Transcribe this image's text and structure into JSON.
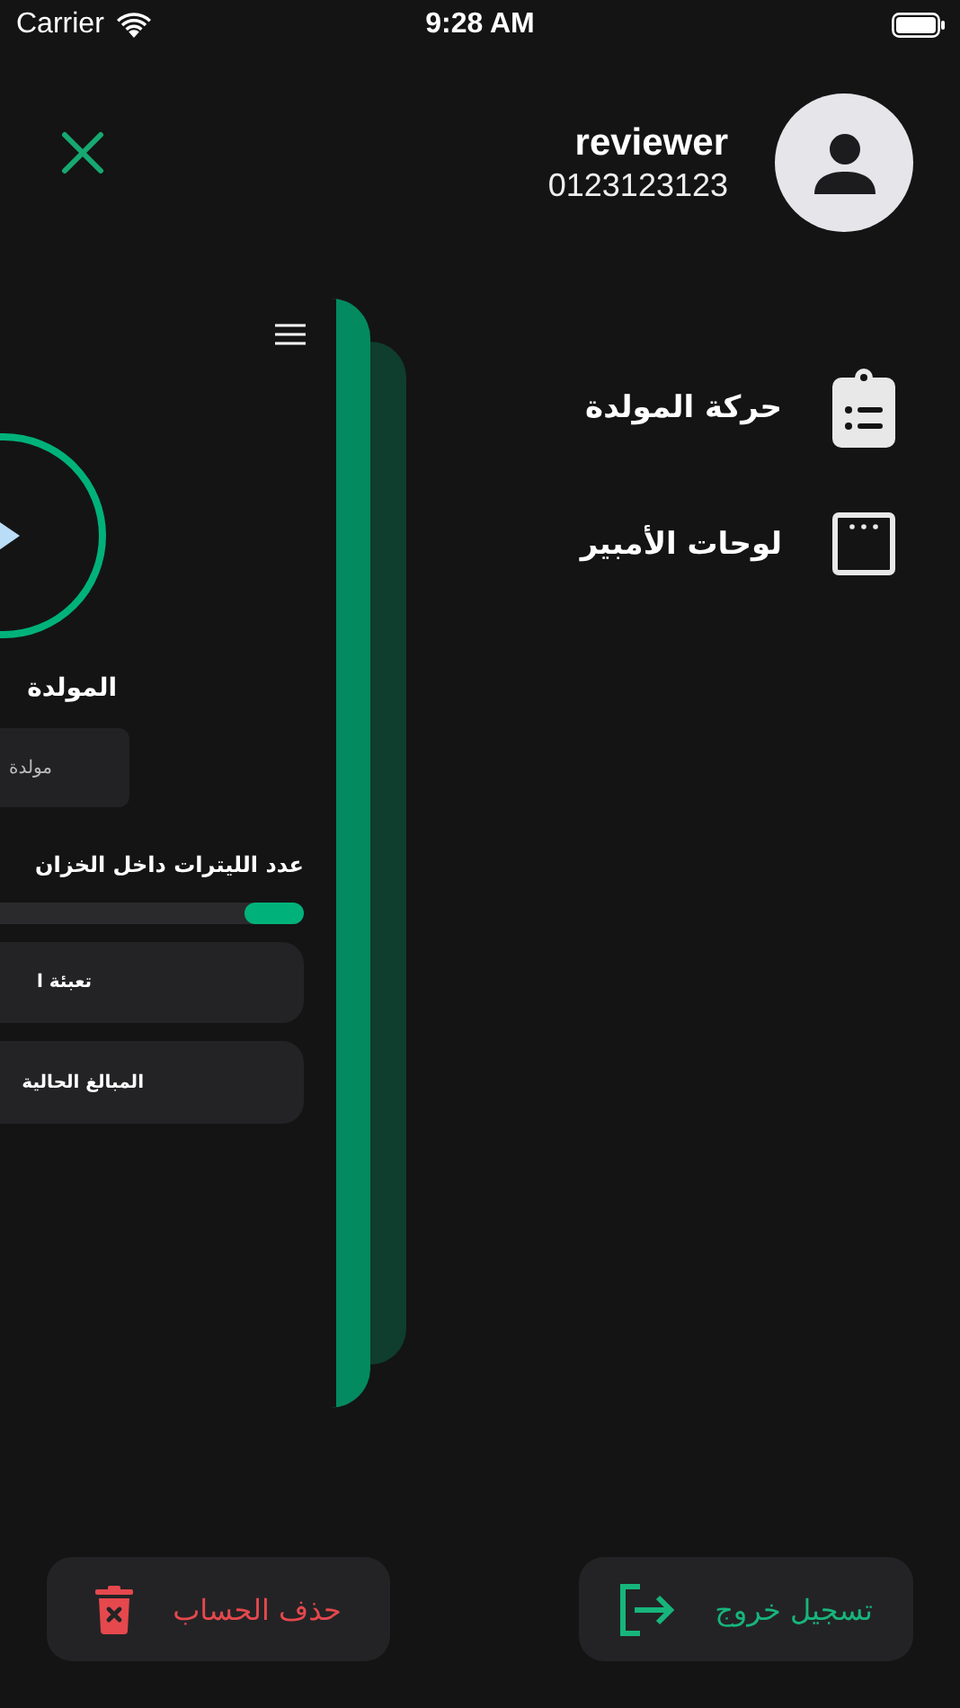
{
  "status_bar": {
    "carrier": "Carrier",
    "time": "9:28 AM"
  },
  "header": {
    "name": "reviewer",
    "phone": "0123123123"
  },
  "menu": [
    {
      "label": "حركة المولدة",
      "kind": "clipboard"
    },
    {
      "label": "لوحات الأمبير",
      "kind": "window"
    }
  ],
  "preview": {
    "title": "المولدة",
    "field_value": "مولدة",
    "tank_label": "عدد الليترات داخل الخزان",
    "tank": {
      "level": 0.16
    },
    "buttons": [
      "تعبئة ا",
      "المبالغ الحالية"
    ]
  },
  "actions": [
    {
      "label": "تسجيل خروج",
      "kind": "logout"
    },
    {
      "label": "حذف الحساب",
      "kind": "delete"
    }
  ]
}
